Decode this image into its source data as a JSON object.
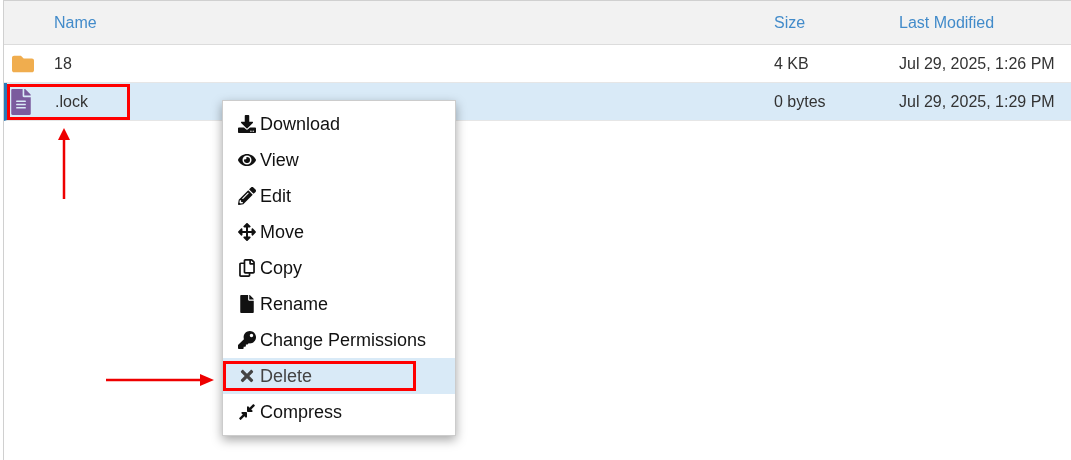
{
  "table": {
    "columns": [
      "Name",
      "Size",
      "Last Modified"
    ],
    "rows": [
      {
        "kind": "folder",
        "name": "18",
        "size": "4 KB",
        "modified": "Jul 29, 2025, 1:26 PM",
        "selected": false,
        "annotated": false
      },
      {
        "kind": "file",
        "name": ".lock",
        "size": "0 bytes",
        "modified": "Jul 29, 2025, 1:29 PM",
        "selected": true,
        "annotated": true
      }
    ]
  },
  "context_menu": {
    "items": [
      {
        "kind": "download",
        "label": "Download",
        "selected": false,
        "annotated": false
      },
      {
        "kind": "view",
        "label": "View",
        "selected": false,
        "annotated": false
      },
      {
        "kind": "edit",
        "label": "Edit",
        "selected": false,
        "annotated": false
      },
      {
        "kind": "move",
        "label": "Move",
        "selected": false,
        "annotated": false
      },
      {
        "kind": "copy",
        "label": "Copy",
        "selected": false,
        "annotated": false
      },
      {
        "kind": "rename",
        "label": "Rename",
        "selected": false,
        "annotated": false
      },
      {
        "kind": "permissions",
        "label": "Change Permissions",
        "selected": false,
        "annotated": false
      },
      {
        "kind": "delete",
        "label": "Delete",
        "selected": true,
        "annotated": true
      },
      {
        "kind": "compress",
        "label": "Compress",
        "selected": false,
        "annotated": false
      }
    ]
  }
}
